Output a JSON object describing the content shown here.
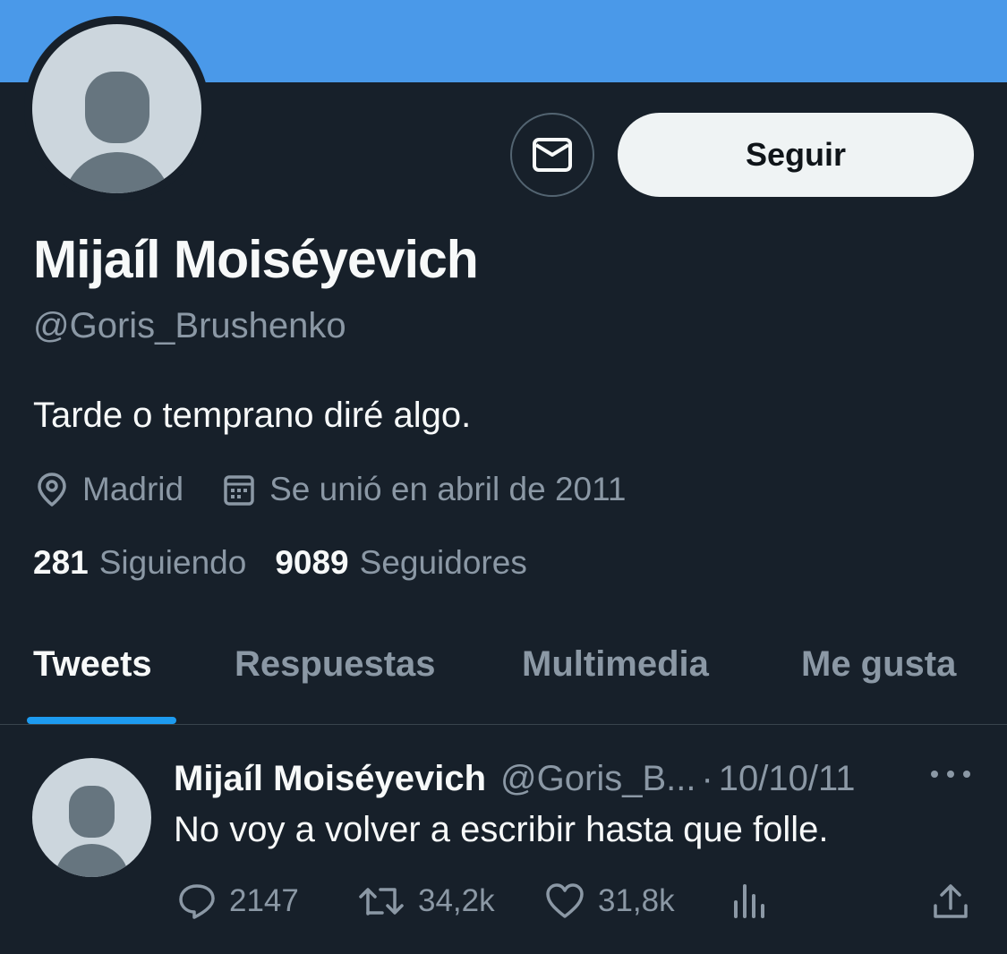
{
  "profile": {
    "display_name": "Mijaíl Moiséyevich",
    "handle": "@Goris_Brushenko",
    "bio": "Tarde o temprano diré algo.",
    "location": "Madrid",
    "joined": "Se unió en abril de 2011",
    "following_count": "281",
    "following_label": "Siguiendo",
    "followers_count": "9089",
    "followers_label": "Seguidores"
  },
  "buttons": {
    "follow_label": "Seguir",
    "message_icon": "mail-icon"
  },
  "tabs": [
    {
      "label": "Tweets",
      "active": true
    },
    {
      "label": "Respuestas",
      "active": false
    },
    {
      "label": "Multimedia",
      "active": false
    },
    {
      "label": "Me gusta",
      "active": false
    }
  ],
  "tweet": {
    "author_name": "Mijaíl Moiséyevich",
    "author_handle": "@Goris_B...",
    "separator": "·",
    "date": "10/10/11",
    "text": "No voy a volver a escribir hasta que folle.",
    "replies": "2147",
    "retweets": "34,2k",
    "likes": "31,8k"
  },
  "colors": {
    "banner": "#4a99e9",
    "background": "#17202a",
    "accent": "#1d9bf0",
    "muted_text": "#8b98a5"
  }
}
